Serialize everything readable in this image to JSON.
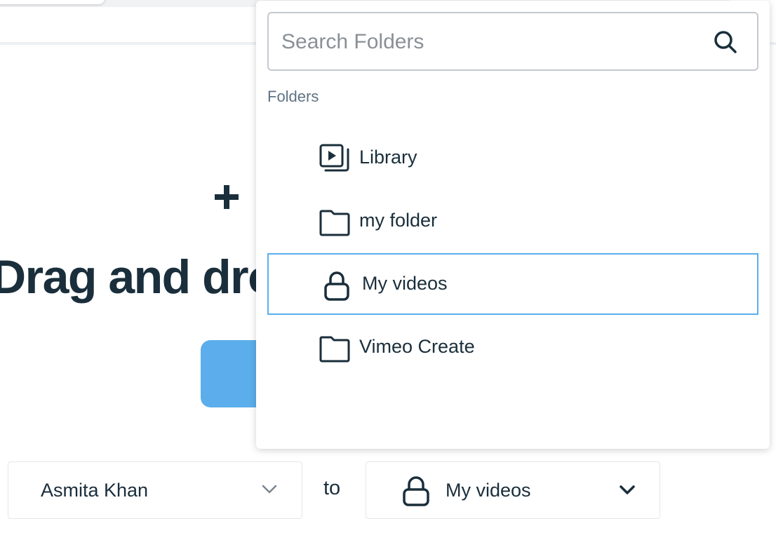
{
  "background": {
    "title": "Drag and dro"
  },
  "owner_select": {
    "value": "Asmita Khan"
  },
  "to_label": "to",
  "folder_select": {
    "value": "My videos",
    "icon": "lock-icon"
  },
  "dropdown": {
    "search": {
      "placeholder": "Search Folders",
      "value": ""
    },
    "section_label": "Folders",
    "items": [
      {
        "label": "Library",
        "icon": "library-icon",
        "selected": false
      },
      {
        "label": "my folder",
        "icon": "folder-icon",
        "selected": false
      },
      {
        "label": "My videos",
        "icon": "lock-icon",
        "selected": true
      },
      {
        "label": "Vimeo Create",
        "icon": "folder-icon",
        "selected": false
      }
    ]
  },
  "colors": {
    "accent": "#5baeeb",
    "text": "#1a2e3b",
    "muted": "#5f7384"
  }
}
